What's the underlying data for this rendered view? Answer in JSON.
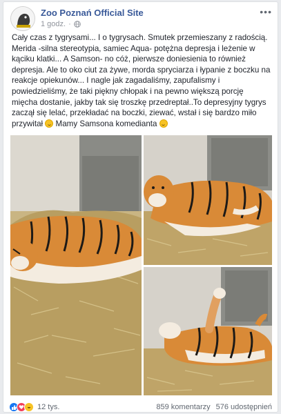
{
  "post": {
    "page_name": "Zoo Poznań Official Site",
    "time": "1 godz.",
    "text_parts": [
      "Cały czas z tygrysami... I o tygrysach. Smutek przemieszany z radością. Merida -silna stereotypia, samiec Aqua- potężna depresja i leżenie w kąciku klatki... A Samson- no cóż, pierwsze doniesienia to również depresja. Ale to oko ciut za żywe, morda spryciarza i łypanie z boczku na reakcje opiekunów... I nagle jak zagadaliśmy, zapufalismy i powiedzieliśmy, że taki piękny chłopak i na pewno większą porcję mięcha dostanie, jakby tak się troszkę przedreptał..To depresyjny tygrys zaczął się lelać, przekładać na boczki, ziewać, wstał i się bardzo miło przywitał ",
      " Mamy Samsona komedianta "
    ]
  },
  "reactions": {
    "count": "12 tys.",
    "comments": "859 komentarzy",
    "shares": "576 udostępnień"
  },
  "icons": {
    "more": "more-options-icon",
    "privacy": "globe-icon",
    "smile": "smile-emoji-icon",
    "like": "like-reaction-icon",
    "love": "love-reaction-icon",
    "haha": "haha-reaction-icon"
  },
  "colors": {
    "link": "#385898",
    "like": "#1877f2",
    "love": "#f33e58",
    "haha": "#f7c325"
  }
}
